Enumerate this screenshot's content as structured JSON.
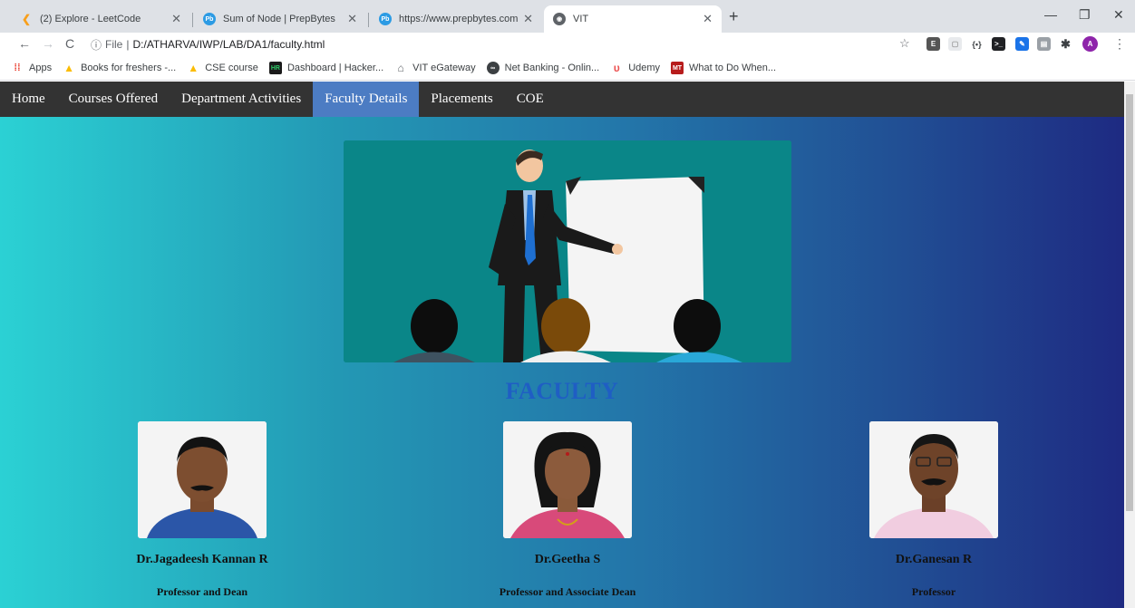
{
  "browser": {
    "tabs": [
      {
        "title": "(2) Explore - LeetCode",
        "icon": "leetcode-icon",
        "active": false
      },
      {
        "title": "Sum of Node | PrepBytes",
        "icon": "prepbytes-icon",
        "active": false
      },
      {
        "title": "https://www.prepbytes.com/pane",
        "icon": "prepbytes-icon",
        "active": false
      },
      {
        "title": "VIT",
        "icon": "globe-icon",
        "active": true
      }
    ],
    "address": {
      "scheme": "File",
      "separator": "|",
      "path": "D:/ATHARVA/IWP/LAB/DA1/faculty.html"
    },
    "bookmarks": [
      {
        "label": "Apps",
        "icon": "apps-grid-icon",
        "color": "#ea4335"
      },
      {
        "label": "Books for freshers -...",
        "icon": "drive-icon",
        "color": "#1a73e8"
      },
      {
        "label": "CSE course",
        "icon": "drive-icon",
        "color": "#1a73e8"
      },
      {
        "label": "Dashboard | Hacker...",
        "icon": "hackerrank-icon",
        "color": "#1a1a1a"
      },
      {
        "label": "VIT eGateway",
        "icon": "vit-icon",
        "color": "#5f6368"
      },
      {
        "label": "Net Banking - Onlin...",
        "icon": "bank-icon",
        "color": "#3c4043"
      },
      {
        "label": "Udemy",
        "icon": "udemy-icon",
        "color": "#ec5252"
      },
      {
        "label": "What to Do When...",
        "icon": "mt-icon",
        "color": "#b71c1c"
      }
    ],
    "profile_initial": "A"
  },
  "site": {
    "nav": [
      {
        "label": "Home",
        "active": false
      },
      {
        "label": "Courses Offered",
        "active": false
      },
      {
        "label": "Department Activities",
        "active": false
      },
      {
        "label": "Faculty Details",
        "active": true
      },
      {
        "label": "Placements",
        "active": false
      },
      {
        "label": "COE",
        "active": false
      }
    ],
    "heading": "FACULTY",
    "faculty": [
      {
        "name": "Dr.Jagadeesh Kannan R",
        "title": "Professor and Dean"
      },
      {
        "name": "Dr.Geetha S",
        "title": "Professor and Associate Dean"
      },
      {
        "name": "Dr.Ganesan R",
        "title": "Professor"
      }
    ],
    "colors": {
      "nav_bg": "#333333",
      "nav_active": "#4c7cc3",
      "heading": "#1f5ec4",
      "gradient_start": "#2bd1d4",
      "gradient_end": "#1e2a82"
    }
  }
}
